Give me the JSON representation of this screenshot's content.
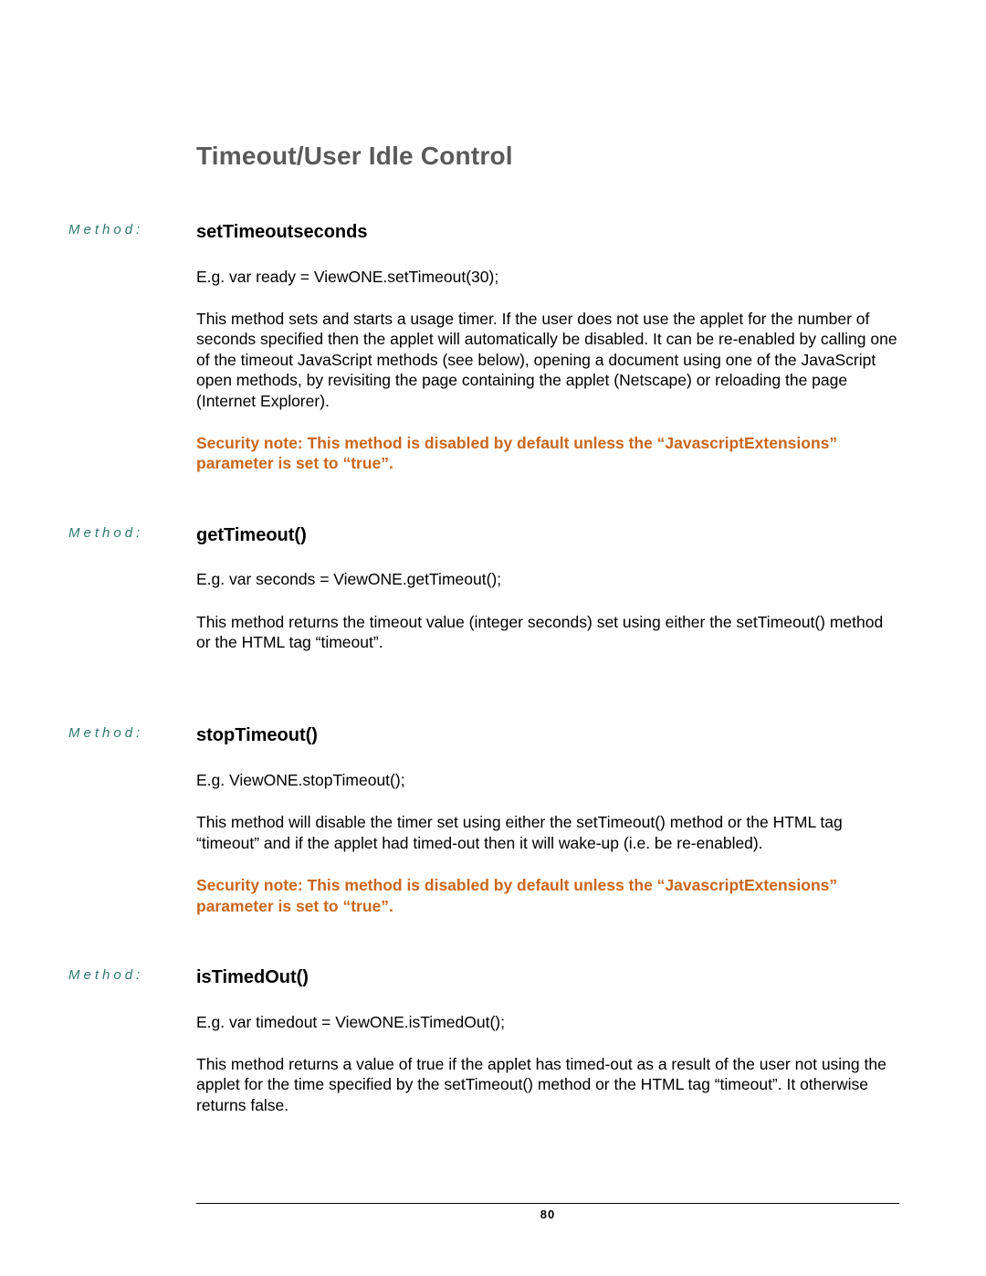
{
  "sectionTitle": "Timeout/User Idle Control",
  "methodLabel": "Method:",
  "methods": [
    {
      "name": "setTimeoutseconds",
      "example": "E.g. var ready = ViewONE.setTimeout(30);",
      "desc": "This method sets and starts a usage timer. If the user does not use the applet for the number of seconds specified then the applet will automatically be disabled. It can be re-enabled by calling one of the timeout JavaScript methods (see below), opening a document using one of the JavaScript open methods, by revisiting the page containing the applet (Netscape) or reloading the page (Internet Explorer).",
      "security": "Security note: This method is disabled by default unless the “JavascriptExtensions” parameter is set to “true”."
    },
    {
      "name": "getTimeout()",
      "example": "E.g. var seconds = ViewONE.getTimeout();",
      "desc": "This method returns the timeout value (integer seconds) set using either the setTimeout() method or the HTML tag “timeout”.",
      "security": ""
    },
    {
      "name": "stopTimeout()",
      "example": "E.g. ViewONE.stopTimeout();",
      "desc": "This method will disable the timer set using either the setTimeout() method or the HTML tag “timeout” and if the applet had timed-out then it will wake-up (i.e. be re-enabled).",
      "security": "Security note: This method is disabled by default unless the “JavascriptExtensions” parameter is set to “true”."
    },
    {
      "name": "isTimedOut()",
      "example": "E.g. var timedout = ViewONE.isTimedOut();",
      "desc": "This method returns a value of true if the applet has timed-out as a result of the user not using the applet for the time specified by the setTimeout() method or the HTML tag “timeout”. It otherwise returns false.",
      "security": ""
    }
  ],
  "pageNumber": "80"
}
